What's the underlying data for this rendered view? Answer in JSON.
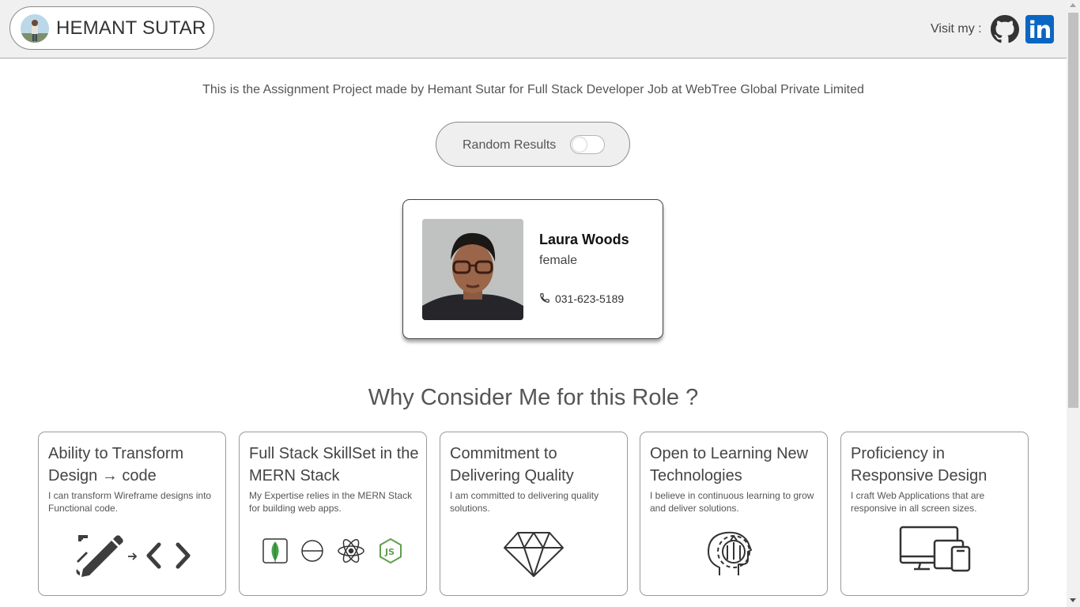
{
  "header": {
    "brand_name": "HEMANT SUTAR",
    "visit_label": "Visit my :",
    "social": [
      {
        "name": "github",
        "icon": "github-icon"
      },
      {
        "name": "linkedin",
        "icon": "linkedin-icon",
        "glyph": "in",
        "color": "#0a66c2"
      }
    ]
  },
  "intro_text": "This is the Assignment Project made by Hemant Sutar for Full Stack Developer Job at WebTree Global Private Limited",
  "toggle": {
    "label": "Random Results",
    "checked": false
  },
  "user_card": {
    "name": "Laura Woods",
    "gender": "female",
    "phone": "031-623-5189"
  },
  "section_title": "Why Consider Me for this Role ?",
  "features": [
    {
      "title": "Ability to Transform Design → code",
      "description": "I can transform Wireframe designs into Functional code.",
      "icon": "design-to-code-icon"
    },
    {
      "title": "Full Stack SkillSet in the MERN Stack",
      "description": "My Expertise relies in the MERN Stack for building web apps.",
      "icon": "mern-stack-icons"
    },
    {
      "title": "Commitment to Delivering Quality",
      "description": "I am committed to delivering quality solutions.",
      "icon": "diamond-icon"
    },
    {
      "title": "Open to Learning New Technologies",
      "description": "I believe in continuous learning to grow and deliver solutions.",
      "icon": "head-gear-icon"
    },
    {
      "title": "Proficiency in Responsive Design",
      "description": "I craft Web Applications that are responsive in all screen sizes.",
      "icon": "responsive-devices-icon"
    }
  ],
  "colors": {
    "header_bg": "#f0f0f0",
    "linkedin": "#0a66c2",
    "mongodb": "#47a248",
    "nodejs": "#5fa04e"
  }
}
